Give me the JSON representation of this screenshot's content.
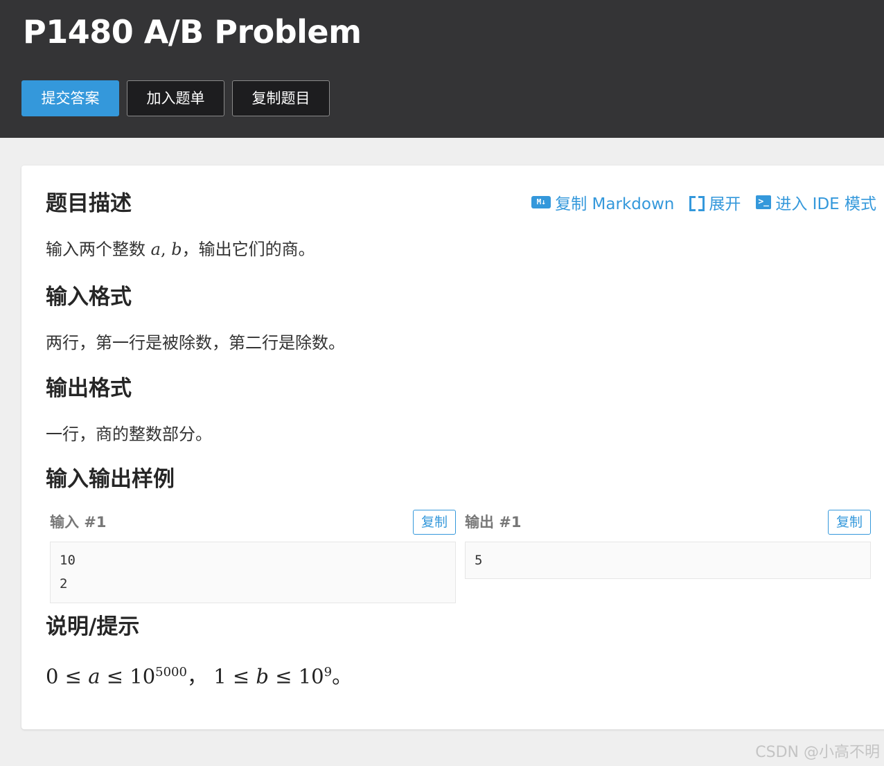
{
  "header": {
    "title": "P1480 A/B Problem",
    "buttons": {
      "submit": "提交答案",
      "add_to_list": "加入题单",
      "copy_problem": "复制题目"
    }
  },
  "toolbar": {
    "copy_markdown": "复制 Markdown",
    "expand": "展开",
    "ide_mode": "进入 IDE 模式"
  },
  "sections": {
    "description": {
      "heading": "题目描述",
      "text_before": "输入两个整数 ",
      "var_a": "a",
      "comma": ", ",
      "var_b": "b",
      "text_after": "，输出它们的商。"
    },
    "input_format": {
      "heading": "输入格式",
      "text": "两行，第一行是被除数，第二行是除数。"
    },
    "output_format": {
      "heading": "输出格式",
      "text": "一行，商的整数部分。"
    },
    "samples": {
      "heading": "输入输出样例",
      "input_label": "输入 #1",
      "output_label": "输出 #1",
      "copy_label": "复制",
      "input_value": "10\n2",
      "output_value": "5"
    },
    "hint": {
      "heading": "说明/提示",
      "zero": "0",
      "leq": "≤",
      "a": "a",
      "ten": "10",
      "exp_a": "5000",
      "sep": "，",
      "one": "1",
      "b": "b",
      "exp_b": "9",
      "end": "。"
    }
  },
  "watermark": "CSDN @小高不明",
  "colors": {
    "accent": "#3498db",
    "header_bg": "#343436",
    "page_bg": "#efefef"
  }
}
